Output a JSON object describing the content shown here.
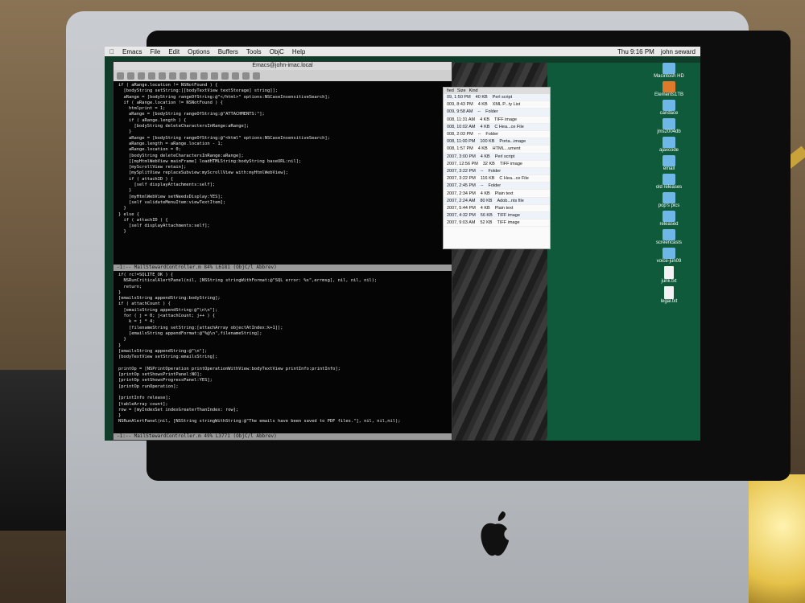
{
  "menubar": {
    "app": "Emacs",
    "items": [
      "File",
      "Edit",
      "Options",
      "Buffers",
      "Tools",
      "ObjC",
      "Help"
    ],
    "clock": "Thu 9:16 PM",
    "user": "john seward"
  },
  "emacs": {
    "title": "Emacs@john-imac.local",
    "top_code": [
      "if ( aRange.location != NSNotFound ) {",
      "  [bodyString setString:[[bodyTextView textStorage] string]];",
      "  aRange = [bodyString rangeOfString:@\"</html>\" options:NSCaseInsensitiveSearch];",
      "  if ( aRange.location != NSNotFound ) {",
      "    htmlprint = 1;",
      "    aRange = [bodyString rangeOfString:@\"ATTACHMENTS:\"];",
      "    if ( aRange.length ) {",
      "      [bodyString deleteCharactersInRange:aRange];",
      "    }",
      "    aRange = [bodyString rangeOfString:@\"<html\" options:NSCaseInsensitiveSearch];",
      "    aRange.length = aRange.location - 1;",
      "    aRange.location = 0;",
      "    [bodyString deleteCharactersInRange:aRange];",
      "    [[myHtmlWebView mainFrame] loadHTMLString:bodyString baseURL:nil];",
      "    [myScrollView retain];",
      "    [mySplitView replaceSubview:myScrollView with:myHtmlWebView];",
      "    if ( attachID ) {",
      "      [self displayAttachments:self];",
      "    }",
      "    [myHtmlWebView setNeedsDisplay:YES];",
      "    [self validateMenuItem:viewTextItem];",
      "  }",
      "} else {",
      "  if ( attachID ) {",
      "    [self displayAttachments:self];",
      "  }"
    ],
    "top_modeline": "-1:--  MailStewardController.m    84% L6181  (ObjC/l Abbrev)",
    "bottom_code": [
      "if( rc!=SQLITE_OK ) {",
      "  NSRunCriticalAlertPanel(nil, [NSString stringWithFormat:@\"SQL error: %s\",errmsg], nil, nil, nil);",
      "  return;",
      "}",
      "[emailsString appendString:bodyString];",
      "if ( attachCount ) {",
      "  [emailsString appendString:@\"\\n\\n\"];",
      "  for ( j = 0; j<attachCount; j++ ) {",
      "    k = j * 4;",
      "    [filenameString setString:[attachArray objectAtIndex:k+1]];",
      "    [emailsString appendFormat:@\"%@\\n\",filenameString];",
      "  }",
      "}",
      "[emailsString appendString:@\"\\n\"];",
      "[bodyTextView setString:emailsString];",
      "",
      "printOp = [NSPrintOperation printOperationWithView:bodyTextView printInfo:printInfo];",
      "[printOp setShowsPrintPanel:NO];",
      "[printOp setShowsProgressPanel:YES];",
      "[printOp runOperation];",
      "",
      "[printInfo release];",
      "[tableArray count];",
      "row = [myIndexSet indexGreaterThanIndex: row];",
      "}",
      "NSRunAlertPanel(nil, [NSString stringWithString:@\"The emails have been saved to PDF files.\"], nil, nil,nil);"
    ],
    "bottom_modeline": "-1:--  MailStewardController.m    49% L3771  (ObjC/l Abbrev)"
  },
  "finder": {
    "columns": [
      "fied",
      "Size",
      "Kind"
    ],
    "rows": [
      [
        "09, 1:50 PM",
        "40 KB",
        "Perl script"
      ],
      [
        "009, 8:43 PM",
        "4 KB",
        "XML P...ty List"
      ],
      [
        "009, 9:58 AM",
        "--",
        "Folder"
      ],
      [
        "008, 11:31 AM",
        "4 KB",
        "TIFF image"
      ],
      [
        "008, 10:02 AM",
        "4 KB",
        "C Hea...ce File"
      ],
      [
        "008, 2:03 PM",
        "--",
        "Folder"
      ],
      [
        "008, 11:00 PM",
        "100 KB",
        "Porta...image"
      ],
      [
        "008, 1:57 PM",
        "4 KB",
        "HTML...ument"
      ],
      [
        "2007, 3:00 PM",
        "4 KB",
        "Perl script"
      ],
      [
        "2007, 12:56 PM",
        "32 KB",
        "TIFF image"
      ],
      [
        "2007, 3:22 PM",
        "--",
        "Folder"
      ],
      [
        "2007, 3:22 PM",
        "116 KB",
        "C Hea...ce File"
      ],
      [
        "2007, 2:45 PM",
        "--",
        "Folder"
      ],
      [
        "2007, 2:34 PM",
        "4 KB",
        "Plain text"
      ],
      [
        "2007, 2:24 AM",
        "80 KB",
        "Adob...nts file"
      ],
      [
        "2007, 5:44 PM",
        "4 KB",
        "Plain text"
      ],
      [
        "2007, 4:32 PM",
        "56 KB",
        "TIFF image"
      ],
      [
        "2007, 9:03 AM",
        "52 KB",
        "TIFF image"
      ]
    ]
  },
  "desktop_icons": [
    {
      "label": "Macintosh HD",
      "kind": "disk"
    },
    {
      "label": "Elements1TB",
      "kind": "disk"
    },
    {
      "label": "candace",
      "kind": "folder"
    },
    {
      "label": "jms2004db",
      "kind": "folder"
    },
    {
      "label": "ajaxcode",
      "kind": "folder"
    },
    {
      "label": "email",
      "kind": "folder"
    },
    {
      "label": "old releases",
      "kind": "folder"
    },
    {
      "label": "pop's pics",
      "kind": "folder"
    },
    {
      "label": "released",
      "kind": "folder"
    },
    {
      "label": "screencasts",
      "kind": "folder"
    },
    {
      "label": "voice-jun09",
      "kind": "folder"
    },
    {
      "label": "junk.txt",
      "kind": "doc"
    },
    {
      "label": "legal.txt",
      "kind": "doc"
    }
  ]
}
